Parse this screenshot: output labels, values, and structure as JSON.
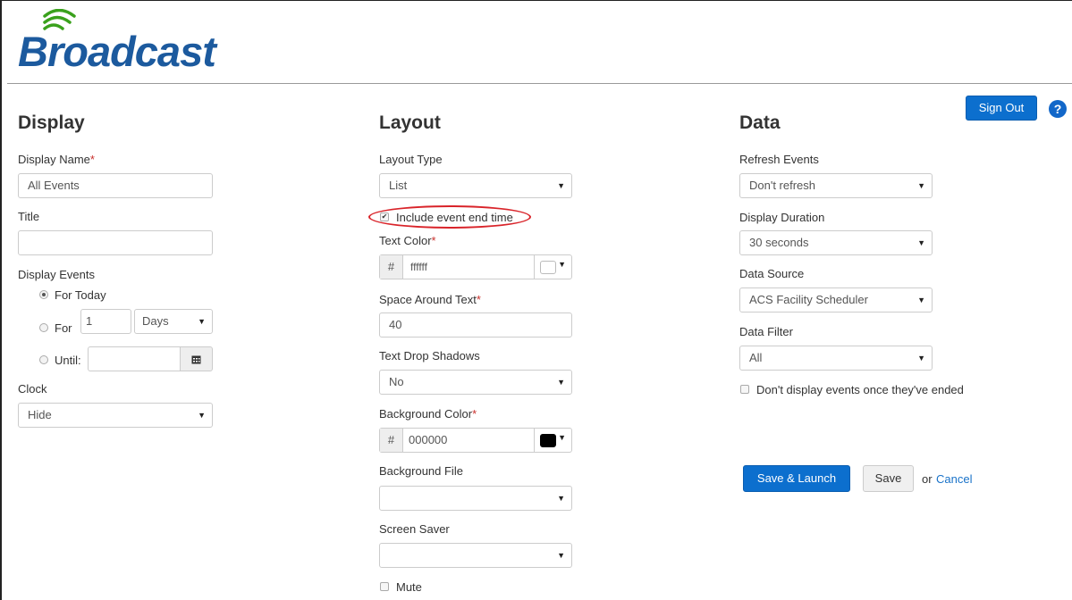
{
  "brand": {
    "name": "Broadcast"
  },
  "header": {
    "sign_out": "Sign Out",
    "help_icon": "question-circle-icon"
  },
  "display": {
    "heading": "Display",
    "display_name_label": "Display Name",
    "display_name_value": "All Events",
    "title_label": "Title",
    "title_value": "",
    "display_events_label": "Display Events",
    "opt_today": "For Today",
    "opt_for": "For",
    "for_count": "1",
    "for_unit": "Days",
    "opt_until": "Until:",
    "until_value": "",
    "calendar_icon": "calendar-icon",
    "clock_label": "Clock",
    "clock_value": "Hide"
  },
  "layout": {
    "heading": "Layout",
    "layout_type_label": "Layout Type",
    "layout_type_value": "List",
    "include_end_time": "Include event end time",
    "include_end_time_checked": true,
    "text_color_label": "Text Color",
    "text_color_hash": "#",
    "text_color_value": "ffffff",
    "text_color_swatch": "#ffffff",
    "space_label": "Space Around Text",
    "space_value": "40",
    "shadows_label": "Text Drop Shadows",
    "shadows_value": "No",
    "bg_color_label": "Background Color",
    "bg_color_hash": "#",
    "bg_color_value": "000000",
    "bg_color_swatch": "#000000",
    "bg_file_label": "Background File",
    "bg_file_value": "",
    "screen_saver_label": "Screen Saver",
    "screen_saver_value": "",
    "mute_label": "Mute"
  },
  "data": {
    "heading": "Data",
    "refresh_label": "Refresh Events",
    "refresh_value": "Don't refresh",
    "duration_label": "Display Duration",
    "duration_value": "30 seconds",
    "source_label": "Data Source",
    "source_value": "ACS Facility Scheduler",
    "filter_label": "Data Filter",
    "filter_value": "All",
    "hide_ended_label": "Don't display events once they've ended"
  },
  "actions": {
    "save_launch": "Save & Launch",
    "save": "Save",
    "or_text": "or",
    "cancel": "Cancel"
  },
  "colors": {
    "primary": "#0c6fce",
    "brand": "#1c5a9e",
    "signal": "#3aa11c",
    "required": "#c9302c",
    "highlight": "#d9242a"
  }
}
